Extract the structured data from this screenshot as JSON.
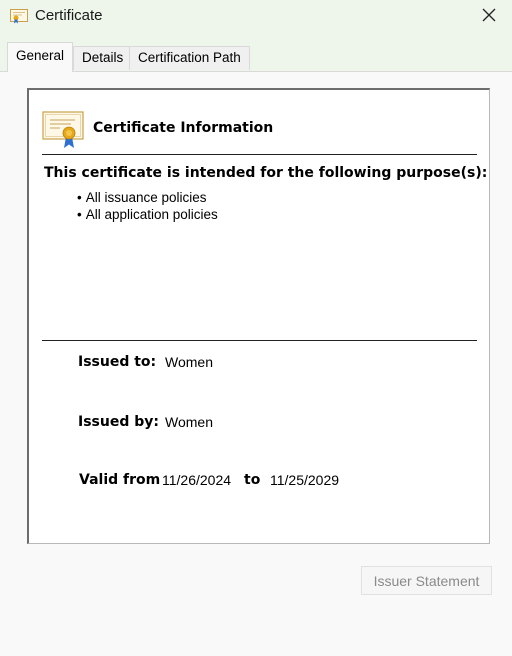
{
  "window": {
    "title": "Certificate",
    "title_icon": "certificate-icon",
    "close_icon": "close-icon"
  },
  "tabs": [
    {
      "label": "General",
      "active": true
    },
    {
      "label": "Details",
      "active": false
    },
    {
      "label": "Certification Path",
      "active": false
    }
  ],
  "general": {
    "info_title": "Certificate Information",
    "purpose_heading": "This certificate is intended for the following purpose(s):",
    "policies": [
      "All issuance policies",
      "All application policies"
    ],
    "issued_to_label": "Issued to:",
    "issued_to": "Women",
    "issued_by_label": "Issued by:",
    "issued_by": "Women",
    "valid_from_label": "Valid from",
    "valid_from": "11/26/2024",
    "to_label": "to",
    "valid_to": "11/25/2029",
    "issuer_statement_label": "Issuer Statement",
    "issuer_statement_enabled": false
  },
  "colors": {
    "titlebar_bg": "#eef5ea",
    "dialog_bg": "#f9f9f9",
    "seal_gold": "#e6a817",
    "ribbon_blue": "#2f6fcf"
  }
}
